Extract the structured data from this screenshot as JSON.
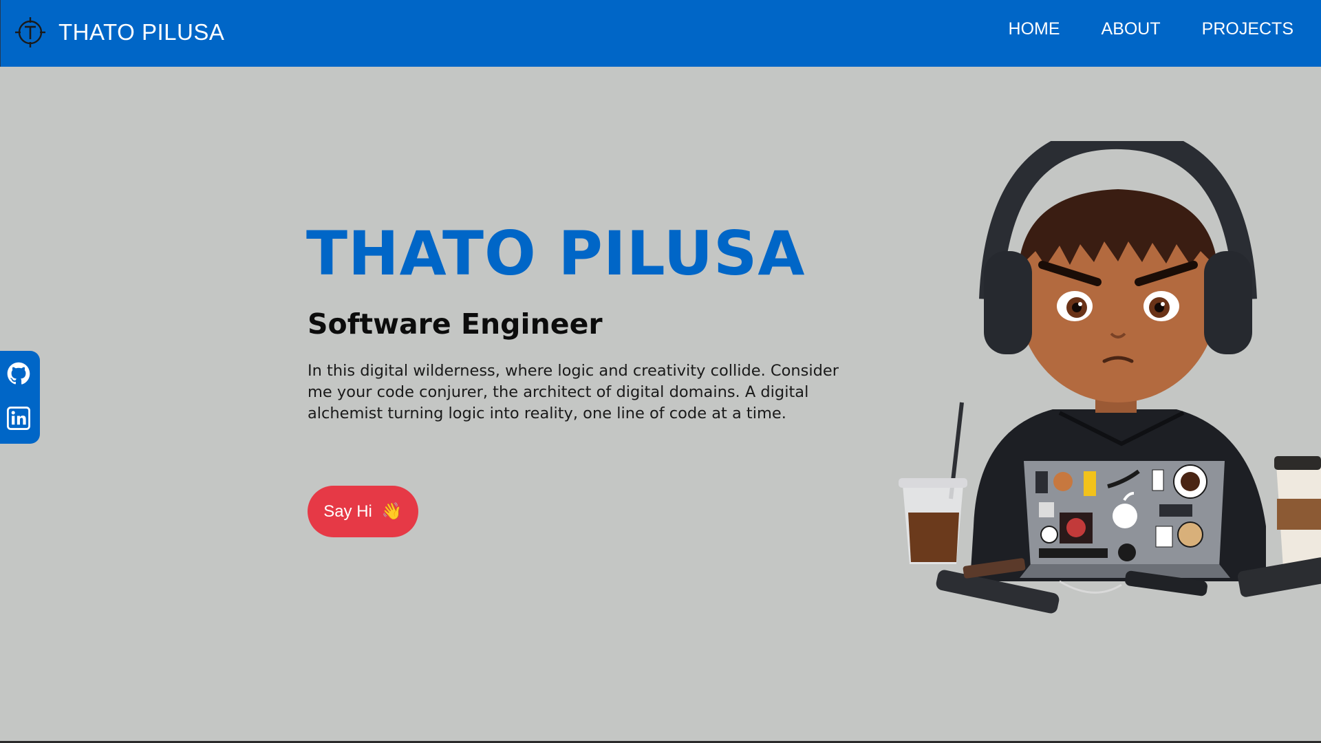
{
  "nav": {
    "brand_name": "THATO PILUSA",
    "logo_icon": "t-crosshair-logo-icon",
    "links": [
      {
        "label": "HOME"
      },
      {
        "label": "ABOUT"
      },
      {
        "label": "PROJECTS"
      }
    ]
  },
  "social": [
    {
      "icon": "github-icon"
    },
    {
      "icon": "linkedin-icon"
    }
  ],
  "hero": {
    "title": "THATO PILUSA",
    "subtitle": "Software Engineer",
    "description": "In this digital wilderness, where logic and creativity collide. Consider me your code conjurer, the architect of digital domains. A digital alchemist turning logic into reality, one line of code at a time.",
    "cta_label": "Say Hi",
    "cta_emoji": "👋"
  },
  "colors": {
    "brand_blue": "#0066c7",
    "background": "#c4c6c4",
    "cta_red": "#e63946",
    "text_dark": "#0c0c0c"
  }
}
